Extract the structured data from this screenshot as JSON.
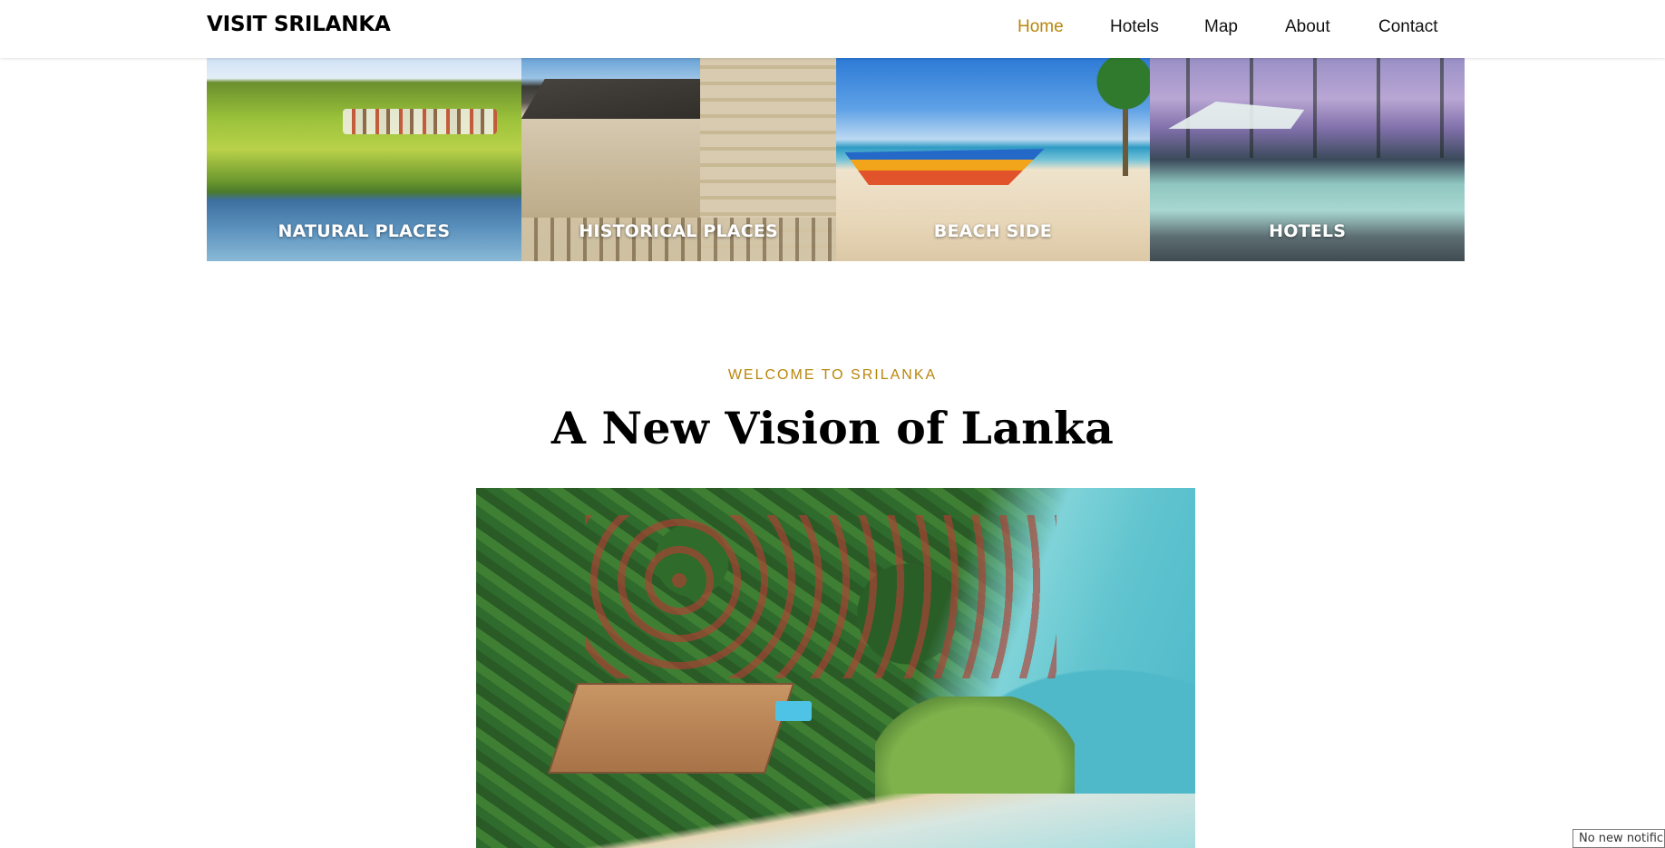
{
  "header": {
    "brand": "VISIT SRILANKA",
    "nav": [
      {
        "label": "Home",
        "active": true
      },
      {
        "label": "Hotels",
        "active": false
      },
      {
        "label": "Map",
        "active": false
      },
      {
        "label": "About",
        "active": false
      },
      {
        "label": "Contact",
        "active": false
      }
    ]
  },
  "categories": [
    {
      "label": "NATURAL PLACES"
    },
    {
      "label": "HISTORICAL PLACES"
    },
    {
      "label": "BEACH SIDE"
    },
    {
      "label": "HOTELS"
    }
  ],
  "welcome": {
    "kicker": "WELCOME TO SRILANKA",
    "headline": "A New Vision of Lanka"
  },
  "notification": {
    "text": "No new notific"
  },
  "colors": {
    "accent": "#b8860b",
    "text": "#111111",
    "background": "#ffffff"
  }
}
